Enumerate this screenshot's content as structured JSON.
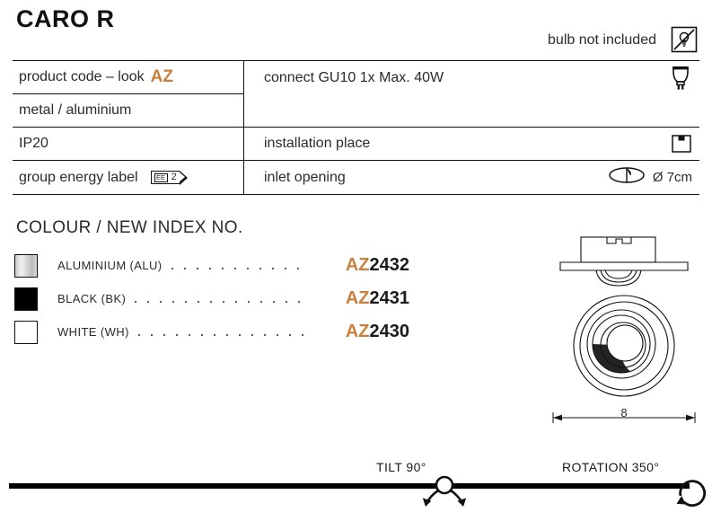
{
  "header": {
    "title": "CARO R",
    "bulb_note": "bulb not included",
    "bulb_crossed_icon": "bulb-not-included-icon"
  },
  "spec_table": {
    "rows": [
      {
        "left_label": "product code – look",
        "left_accent": "AZ",
        "right_label": "connect GU10 1x Max. 40W",
        "right_icon": "gu10-lamp-icon"
      },
      {
        "left_label": "metal / aluminium",
        "right_label": "",
        "right_icon": ""
      },
      {
        "left_label": "IP20",
        "right_label": "installation place",
        "right_icon": "ceiling-recessed-icon"
      },
      {
        "left_label": "group energy label",
        "left_badge": {
          "code": "EE",
          "value": "2"
        },
        "right_label": "inlet opening",
        "right_icon": "inlet-opening-icon",
        "right_value": "Ø 7cm"
      }
    ]
  },
  "colour_section": {
    "heading": "COLOUR / NEW INDEX NO.",
    "items": [
      {
        "name": "ALUMINIUM (ALU)",
        "swatch": "aluminium-gradient",
        "code_prefix": "AZ",
        "code_number": "2432"
      },
      {
        "name": "BLACK (BK)",
        "swatch": "#000000",
        "code_prefix": "AZ",
        "code_number": "2431"
      },
      {
        "name": "WHITE (WH)",
        "swatch": "#ffffff",
        "code_prefix": "AZ",
        "code_number": "2430"
      }
    ]
  },
  "drawing": {
    "name": "recessed-downlight-technical-drawing",
    "dimension_label": "8"
  },
  "footer": {
    "tilt_label": "TILT 90°",
    "rotation_label": "ROTATION 350°",
    "tilt_icon": "tilt-arrows-icon",
    "rotation_icon": "rotation-arrow-icon"
  },
  "colors": {
    "accent_orange": "#c8803c",
    "ink": "#1a1a1a",
    "rule": "#111111"
  }
}
